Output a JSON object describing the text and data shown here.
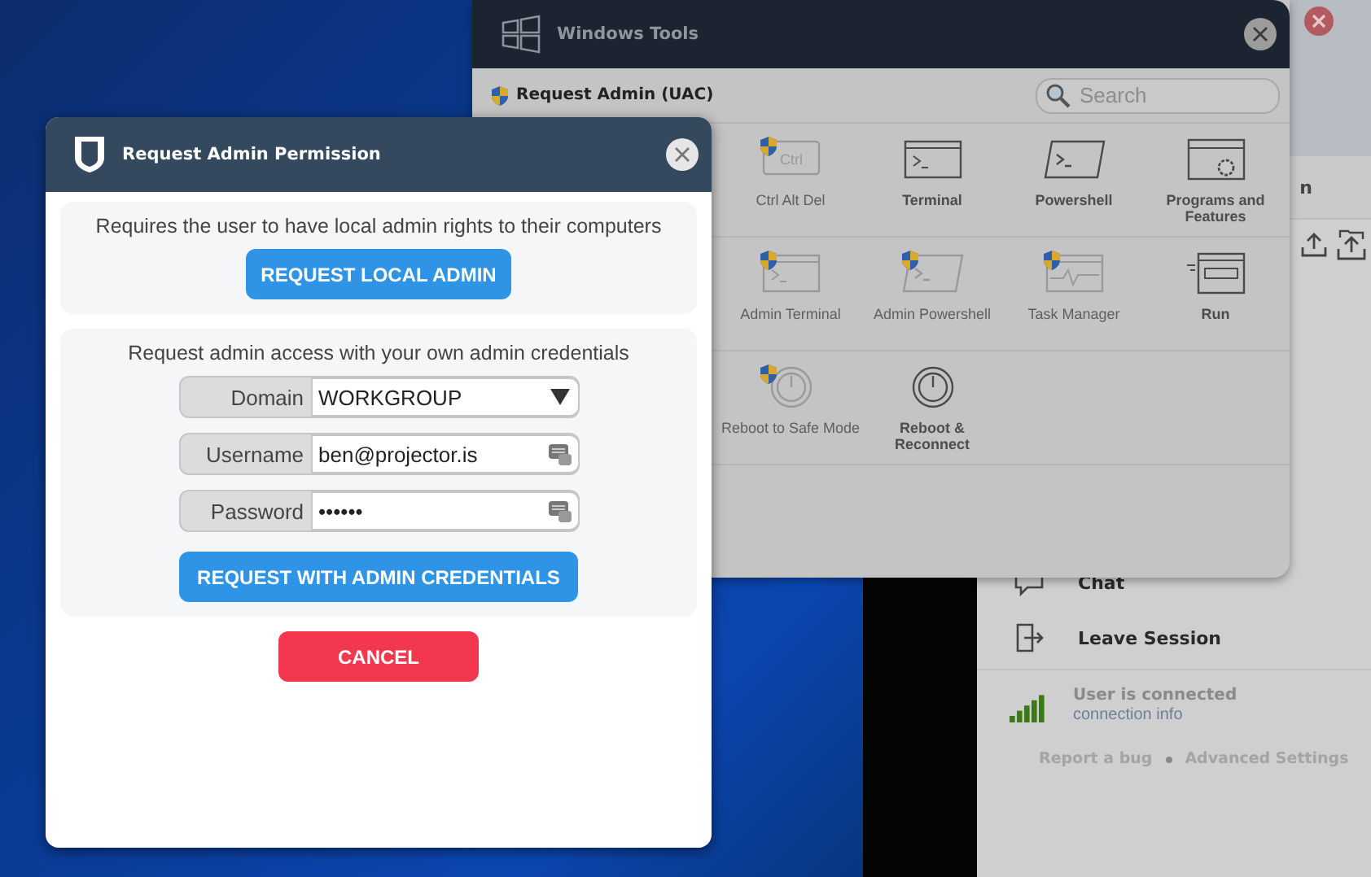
{
  "side_panel": {
    "tab_fragment": "n",
    "items": [
      {
        "kind": "chat",
        "label": "Chat"
      },
      {
        "kind": "leave",
        "label": "Leave Session"
      }
    ],
    "status": {
      "text": "User is connected",
      "link": "connection info"
    },
    "footer_links": [
      "Report a bug",
      "Advanced Settings"
    ]
  },
  "tools_window": {
    "title": "Windows Tools",
    "toolbar_label": "Request Admin (UAC)",
    "search": {
      "placeholder": "Search"
    },
    "rows": [
      [
        {
          "label": "Ctrl Alt Del",
          "kind": "ctrl",
          "key_label": "Ctrl",
          "admin": true,
          "disabled": true
        },
        {
          "label": "Terminal",
          "kind": "terminal",
          "admin": false,
          "disabled": false
        },
        {
          "label": "Powershell",
          "kind": "powershell",
          "admin": false,
          "disabled": false
        },
        {
          "label": "Programs and Features",
          "kind": "programs",
          "admin": false,
          "disabled": false
        }
      ],
      [
        {
          "label": "Admin Terminal",
          "kind": "terminal",
          "admin": true,
          "disabled": true
        },
        {
          "label": "Admin Powershell",
          "kind": "powershell",
          "admin": true,
          "disabled": true
        },
        {
          "label": "Task Manager",
          "kind": "monitor",
          "admin": true,
          "disabled": true
        },
        {
          "label": "Run",
          "kind": "run",
          "admin": false,
          "disabled": false
        }
      ],
      [
        {
          "label": "Reboot to Safe Mode",
          "kind": "power",
          "admin": true,
          "disabled": true
        },
        {
          "label": "Reboot & Reconnect",
          "kind": "power",
          "admin": false,
          "disabled": false
        }
      ]
    ]
  },
  "dialog": {
    "title": "Request Admin Permission",
    "local_section": {
      "text": "Requires the user to have local admin rights to their computers",
      "button": "REQUEST LOCAL ADMIN"
    },
    "credentials_section": {
      "text": "Request admin access with your own admin credentials",
      "fields": [
        {
          "kind": "select",
          "label": "Domain",
          "value": "WORKGROUP"
        },
        {
          "kind": "text",
          "label": "Username",
          "value": "ben@projector.is"
        },
        {
          "kind": "password",
          "label": "Password",
          "value": "••••••"
        }
      ],
      "button": "REQUEST WITH ADMIN CREDENTIALS"
    },
    "cancel": "CANCEL"
  }
}
